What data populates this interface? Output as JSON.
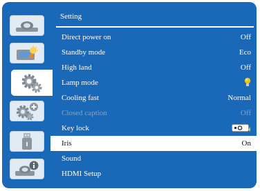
{
  "menu": {
    "title": "Setting",
    "tabs": [
      {
        "icon": "display-icon"
      },
      {
        "icon": "picture-adjust-icon"
      },
      {
        "icon": "setting-gear-icon"
      },
      {
        "icon": "extended-settings-icon"
      },
      {
        "icon": "usb-icon"
      },
      {
        "icon": "information-icon"
      }
    ],
    "active_tab": 2,
    "rows": [
      {
        "label": "Direct power on",
        "value": "Off"
      },
      {
        "label": "Standby mode",
        "value": "Eco"
      },
      {
        "label": "High land",
        "value": "Off"
      },
      {
        "label": "Lamp mode",
        "value": "",
        "icon": "lamp-bulb-icon"
      },
      {
        "label": "Cooling fast",
        "value": "Normal"
      },
      {
        "label": "Closed caption",
        "value": "Off",
        "disabled": true
      },
      {
        "label": "Key lock",
        "value": "",
        "icon": "key-lock-icon"
      },
      {
        "label": "Iris",
        "value": "On",
        "selected": true
      },
      {
        "label": "Sound",
        "value": ""
      },
      {
        "label": "HDMI Setup",
        "value": ""
      }
    ]
  },
  "colors": {
    "background": "#1a68b8",
    "tab": "#e2ebf3",
    "selected_row": "#ffffff",
    "disabled_text": "#7fa6cf",
    "lamp_bulb": "#f2c515"
  }
}
